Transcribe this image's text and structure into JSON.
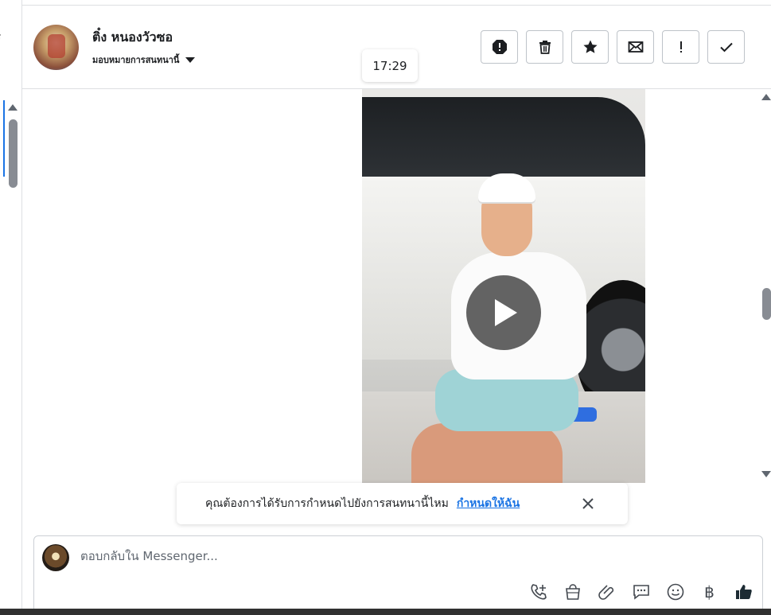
{
  "left_rail": {
    "cut_text": "ร"
  },
  "header": {
    "contact_name": "ติ๋ง หนองวัวซอ",
    "assign_label": "มอบหมายการสนทนานี้",
    "toolbar": [
      {
        "name": "spam-button",
        "icon": "exclamation-circle-icon"
      },
      {
        "name": "delete-button",
        "icon": "trash-icon"
      },
      {
        "name": "star-button",
        "icon": "star-icon"
      },
      {
        "name": "mark-unread-button",
        "icon": "envelope-icon"
      },
      {
        "name": "follow-up-button",
        "icon": "exclamation-icon"
      },
      {
        "name": "mark-done-button",
        "icon": "check-icon"
      }
    ]
  },
  "thread": {
    "timestamp": "17:29",
    "video": {
      "icon": "play-icon"
    }
  },
  "assign_banner": {
    "message": "คุณต้องการได้รับการกำหนดไปยังการสนทนานี้ไหม",
    "link": "กำหนดให้ฉัน"
  },
  "composer": {
    "placeholder": "ตอบกลับใน Messenger...",
    "tools": [
      {
        "name": "call-plus-icon"
      },
      {
        "name": "shopping-bag-icon"
      },
      {
        "name": "attachment-icon"
      },
      {
        "name": "saved-reply-icon"
      },
      {
        "name": "emoji-icon"
      },
      {
        "name": "baht-icon",
        "glyph": "฿"
      },
      {
        "name": "thumbs-up-icon",
        "color": "#1c2b33"
      }
    ]
  }
}
